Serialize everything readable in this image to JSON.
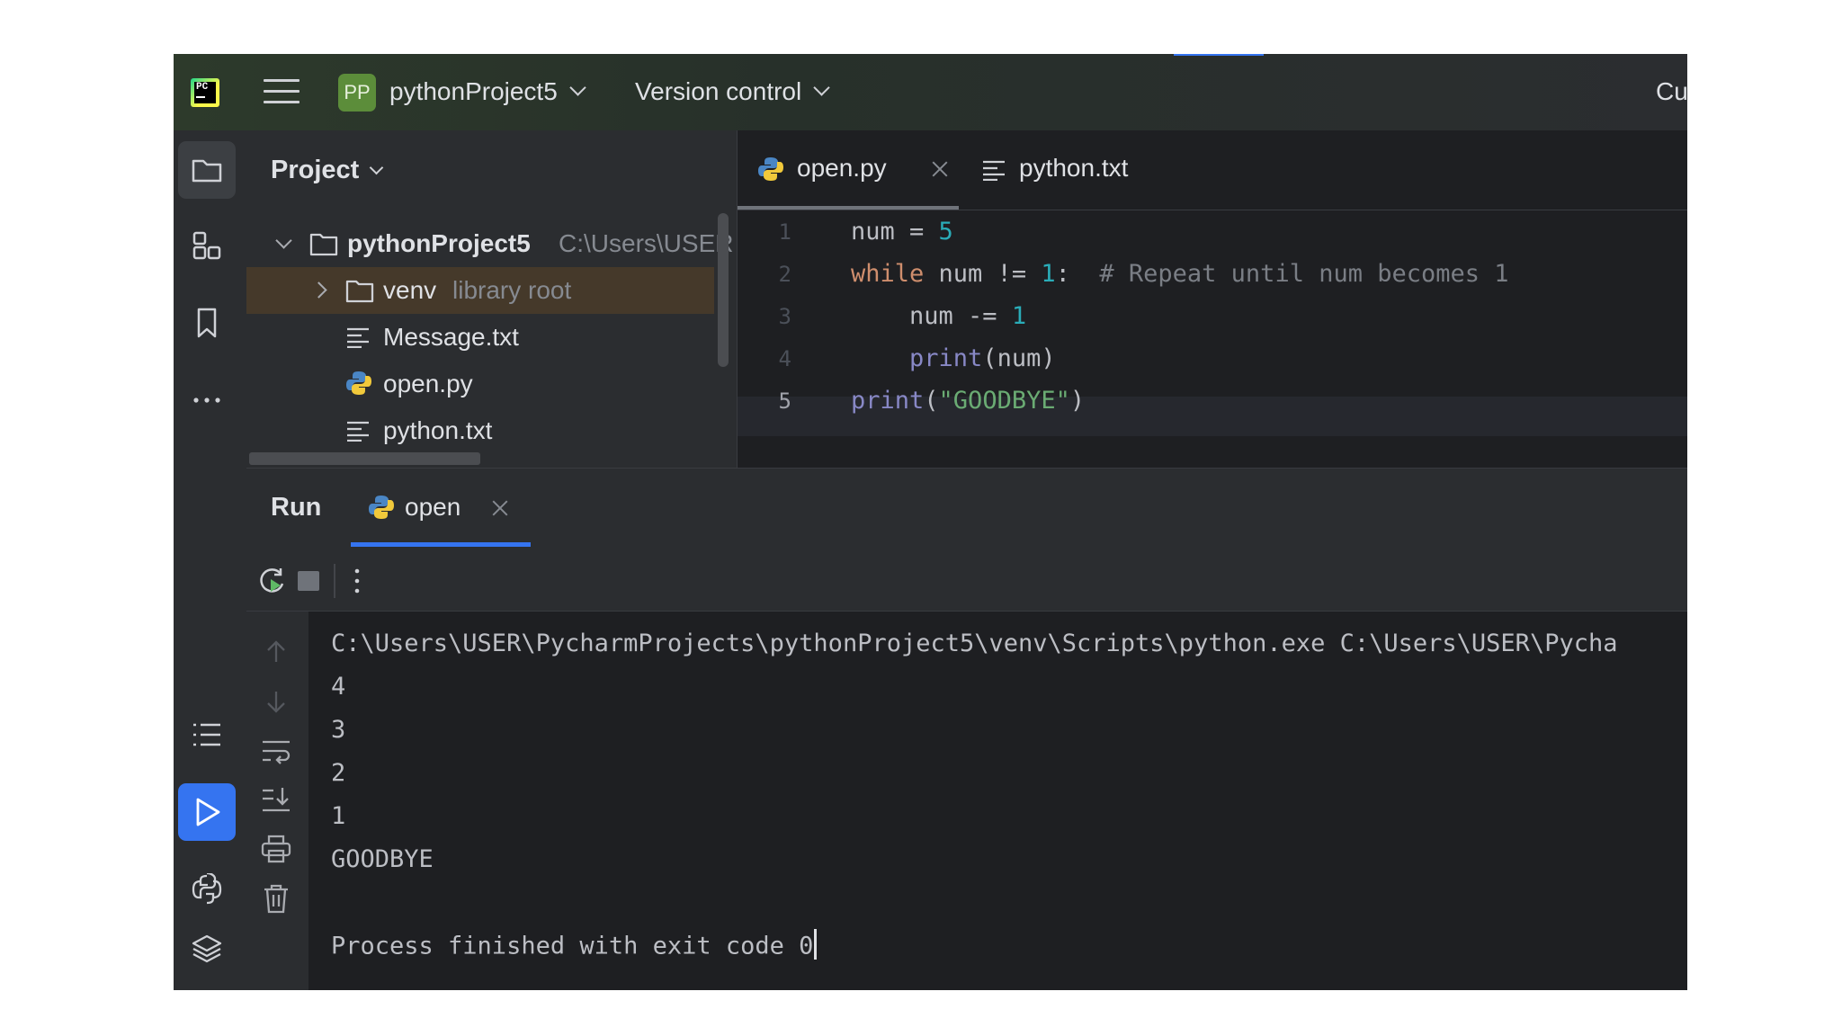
{
  "topbar": {
    "logo_text": "PC",
    "project_badge": "PP",
    "project_name": "pythonProject5",
    "version_control": "Version control",
    "right_clipped": "Cu"
  },
  "toolstrip": {
    "icons": [
      "folder-icon",
      "structure-icon",
      "bookmark-icon",
      "more-icon",
      "todo-list-icon",
      "run-icon",
      "python-console-icon",
      "layers-icon"
    ]
  },
  "project_panel": {
    "title": "Project",
    "tree": [
      {
        "label": "pythonProject5",
        "hint": "C:\\Users\\USER",
        "icon": "folder-icon",
        "expanded": true
      },
      {
        "label": "venv",
        "hint": "library root",
        "icon": "folder-icon",
        "expanded": false
      },
      {
        "label": "Message.txt",
        "hint": "",
        "icon": "text-file-icon"
      },
      {
        "label": "open.py",
        "hint": "",
        "icon": "python-file-icon"
      },
      {
        "label": "python.txt",
        "hint": "",
        "icon": "text-file-icon"
      }
    ]
  },
  "editor": {
    "tabs": [
      {
        "label": "open.py",
        "active": true
      },
      {
        "label": "python.txt",
        "active": false
      }
    ],
    "line_numbers": [
      "1",
      "2",
      "3",
      "4",
      "5"
    ],
    "current_line": "5",
    "code": [
      "num = 5",
      "while num != 1:  # Repeat until num becomes 1",
      "    num -= 1",
      "    print(num)",
      "print(\"GOODBYE\")"
    ]
  },
  "run_panel": {
    "title": "Run",
    "tab_label": "open",
    "console_lines": [
      "C:\\Users\\USER\\PycharmProjects\\pythonProject5\\venv\\Scripts\\python.exe C:\\Users\\USER\\Pycha",
      "4",
      "3",
      "2",
      "1",
      "GOODBYE",
      "",
      "Process finished with exit code 0"
    ]
  },
  "colors": {
    "accent": "#3574f0",
    "keyword": "#cf8e6d",
    "number": "#2aacb8",
    "comment": "#7a7e85",
    "builtin": "#8888c6",
    "string": "#6aab73"
  }
}
